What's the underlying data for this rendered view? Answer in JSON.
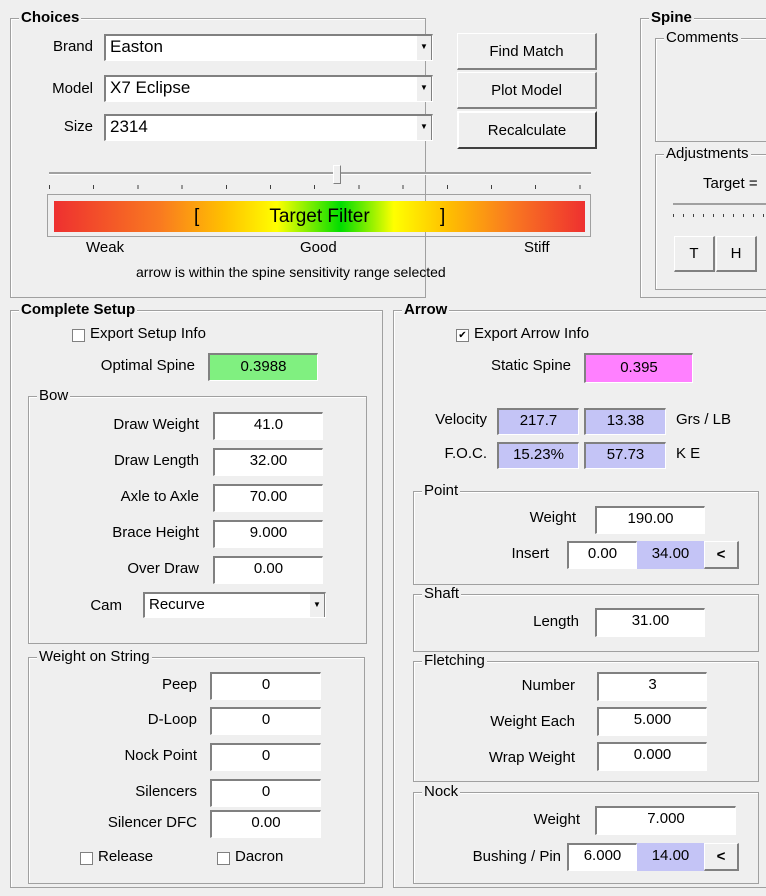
{
  "choices": {
    "title": "Choices",
    "brand_label": "Brand",
    "brand": "Easton",
    "model_label": "Model",
    "model": "X7 Eclipse",
    "size_label": "Size",
    "size": "2314",
    "find_match": "Find Match",
    "plot_model": "Plot Model",
    "recalculate": "Recalculate",
    "filter_text": "Target Filter",
    "bracket_left": "[",
    "bracket_right": "]",
    "weak": "Weak",
    "good": "Good",
    "stiff": "Stiff",
    "message": "arrow is within the spine sensitivity range selected",
    "slider_position_percent": 54
  },
  "spine": {
    "title": "Spine",
    "comments": "Comments",
    "adjustments": "Adjustments",
    "target": "Target =",
    "t_button": "T",
    "h_button": "H"
  },
  "setup": {
    "title": "Complete Setup",
    "export": "Export Setup Info",
    "export_checked": false,
    "optimal_label": "Optimal Spine",
    "optimal": "0.3988",
    "bow": {
      "title": "Bow",
      "fields": [
        {
          "label": "Draw Weight",
          "value": "41.0"
        },
        {
          "label": "Draw Length",
          "value": "32.00"
        },
        {
          "label": "Axle to Axle",
          "value": "70.00"
        },
        {
          "label": "Brace Height",
          "value": "9.000"
        },
        {
          "label": "Over Draw",
          "value": "0.00"
        }
      ],
      "cam_label": "Cam",
      "cam": "Recurve"
    },
    "string": {
      "title": "Weight on String",
      "fields": [
        {
          "label": "Peep",
          "value": "0"
        },
        {
          "label": "D-Loop",
          "value": "0"
        },
        {
          "label": "Nock Point",
          "value": "0"
        },
        {
          "label": "Silencers",
          "value": "0"
        },
        {
          "label": "Silencer DFC",
          "value": "0.00"
        }
      ],
      "release": "Release",
      "dacron": "Dacron"
    }
  },
  "arrow": {
    "title": "Arrow",
    "export": "Export Arrow Info",
    "export_checked": true,
    "static_label": "Static Spine",
    "static": "0.395",
    "velocity_label": "Velocity",
    "velocity": "217.7",
    "grs_lb": "13.38",
    "grs_lb_label": "Grs / LB",
    "foc_label": "F.O.C.",
    "foc": "15.23%",
    "ke": "57.73",
    "ke_label": "K E",
    "point": {
      "title": "Point",
      "weight_label": "Weight",
      "weight": "190.00",
      "insert_label": "Insert",
      "insert": "0.00",
      "insert_total": "34.00",
      "arrow_btn": "<"
    },
    "shaft": {
      "title": "Shaft",
      "length_label": "Length",
      "length": "31.00"
    },
    "fletching": {
      "title": "Fletching",
      "number_label": "Number",
      "number": "3",
      "each_label": "Weight Each",
      "each": "5.000",
      "wrap_label": "Wrap Weight",
      "wrap": "0.000"
    },
    "nock": {
      "title": "Nock",
      "weight_label": "Weight",
      "weight": "7.000",
      "bushing_label": "Bushing / Pin",
      "bushing": "6.000",
      "bushing_total": "14.00",
      "arrow_btn": "<"
    }
  },
  "colors": {
    "optimal": "#80f080",
    "static": "#ff80ff",
    "readonly": "#c4c4f6"
  }
}
